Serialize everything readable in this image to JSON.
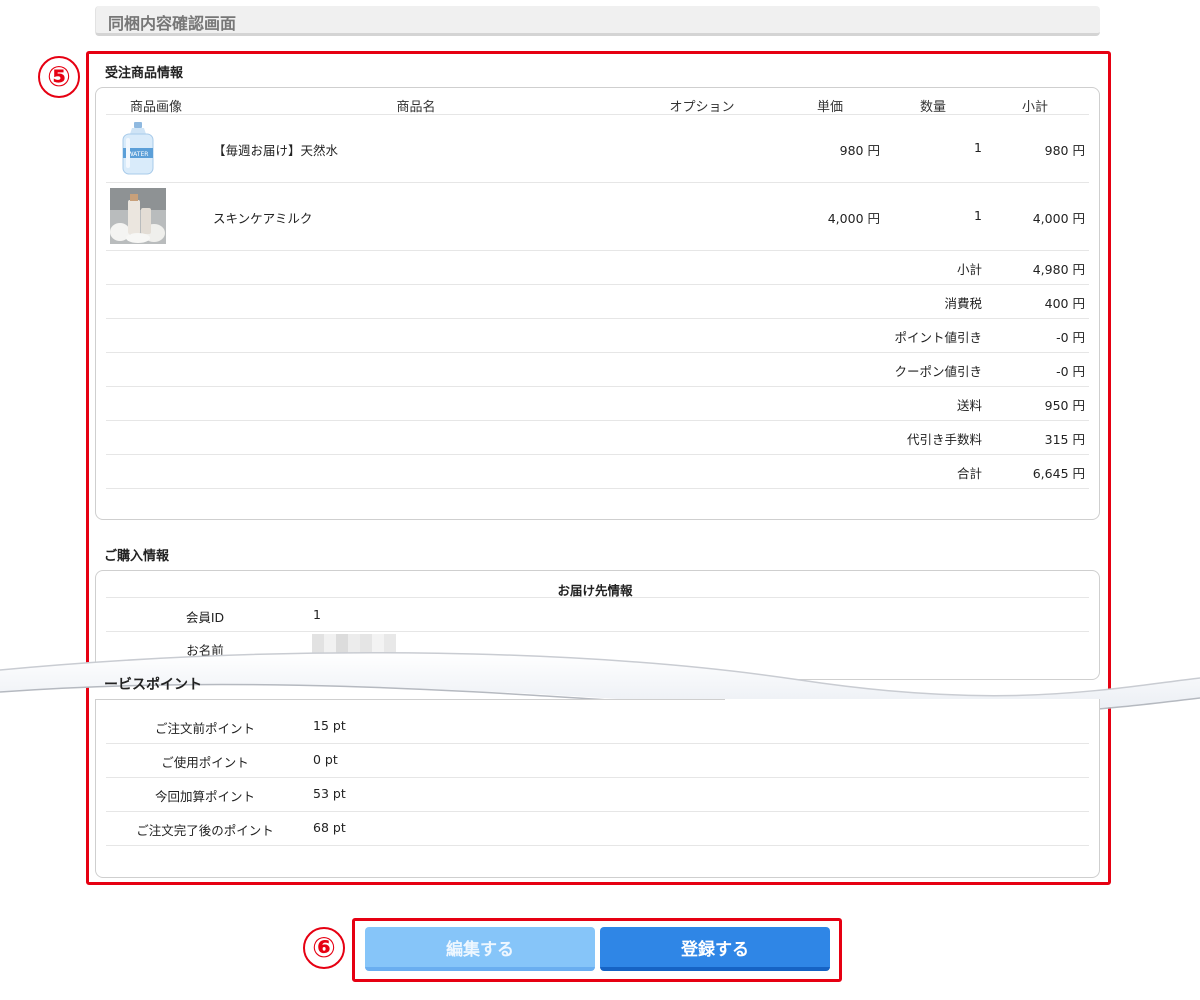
{
  "page": {
    "title": "同梱内容確認画面"
  },
  "markers": {
    "first": "⑤",
    "second": "⑥"
  },
  "colors": {
    "highlight": "#e60012",
    "primary_button": "#2f86e6",
    "secondary_button": "#86c5f9"
  },
  "order_items": {
    "title": "受注商品情報",
    "columns": [
      "商品画像",
      "商品名",
      "オプション",
      "単価",
      "数量",
      "小計"
    ],
    "rows": [
      {
        "image_icon": "water-bottle-image",
        "name": "【毎週お届け】天然水",
        "option": "",
        "unit_price": "980 円",
        "quantity": "1",
        "subtotal": "980 円"
      },
      {
        "image_icon": "skincare-bottle-image",
        "name": "スキンケアミルク",
        "option": "",
        "unit_price": "4,000 円",
        "quantity": "1",
        "subtotal": "4,000 円"
      }
    ],
    "summary": [
      {
        "label": "小計",
        "value": "4,980 円"
      },
      {
        "label": "消費税",
        "value": "400 円"
      },
      {
        "label": "ポイント値引き",
        "value": "-0 円"
      },
      {
        "label": "クーポン値引き",
        "value": "-0 円"
      },
      {
        "label": "送料",
        "value": "950 円"
      },
      {
        "label": "代引き手数料",
        "value": "315 円"
      },
      {
        "label": "合計",
        "value": "6,645 円"
      }
    ]
  },
  "purchase_info": {
    "title": "ご購入情報",
    "subheader": "お届け先情報",
    "rows": [
      {
        "label": "会員ID",
        "value": "1"
      },
      {
        "label": "お名前",
        "value": ""
      }
    ]
  },
  "points": {
    "title": "ービスポイント",
    "rows": [
      {
        "label": "ご注文前ポイント",
        "value": "15 pt"
      },
      {
        "label": "ご使用ポイント",
        "value": "0 pt"
      },
      {
        "label": "今回加算ポイント",
        "value": "53 pt"
      },
      {
        "label": "ご注文完了後のポイント",
        "value": "68 pt"
      }
    ]
  },
  "buttons": {
    "edit": "編集する",
    "register": "登録する"
  }
}
